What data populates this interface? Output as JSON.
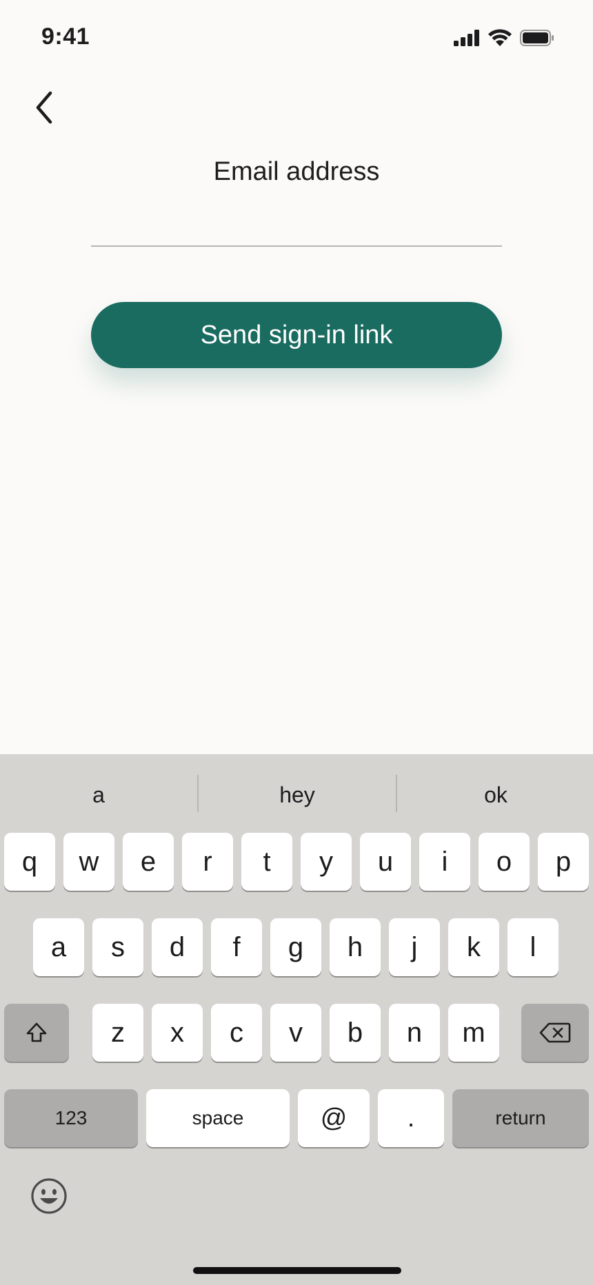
{
  "status_bar": {
    "time": "9:41",
    "icons": [
      "cellular-signal-icon",
      "wifi-icon",
      "battery-icon"
    ]
  },
  "header": {
    "back_icon": "chevron-left-icon"
  },
  "form": {
    "email_label": "Email address",
    "email_value": "",
    "email_placeholder": "",
    "send_button_label": "Send sign-in link"
  },
  "colors": {
    "background": "#fbfaf8",
    "accent": "#1a6b60",
    "keyboard_bg": "#d6d4d1",
    "key_bg": "#ffffff",
    "func_key_bg": "#adacaa"
  },
  "keyboard": {
    "suggestions": [
      "a",
      "hey",
      "ok"
    ],
    "row1": [
      "q",
      "w",
      "e",
      "r",
      "t",
      "y",
      "u",
      "i",
      "o",
      "p"
    ],
    "row2": [
      "a",
      "s",
      "d",
      "f",
      "g",
      "h",
      "j",
      "k",
      "l"
    ],
    "row3": [
      "z",
      "x",
      "c",
      "v",
      "b",
      "n",
      "m"
    ],
    "shift_icon": "shift-icon",
    "backspace_icon": "backspace-icon",
    "numbers_label": "123",
    "space_label": "space",
    "at_label": "@",
    "period_label": ".",
    "return_label": "return",
    "emoji_icon": "emoji-icon"
  }
}
